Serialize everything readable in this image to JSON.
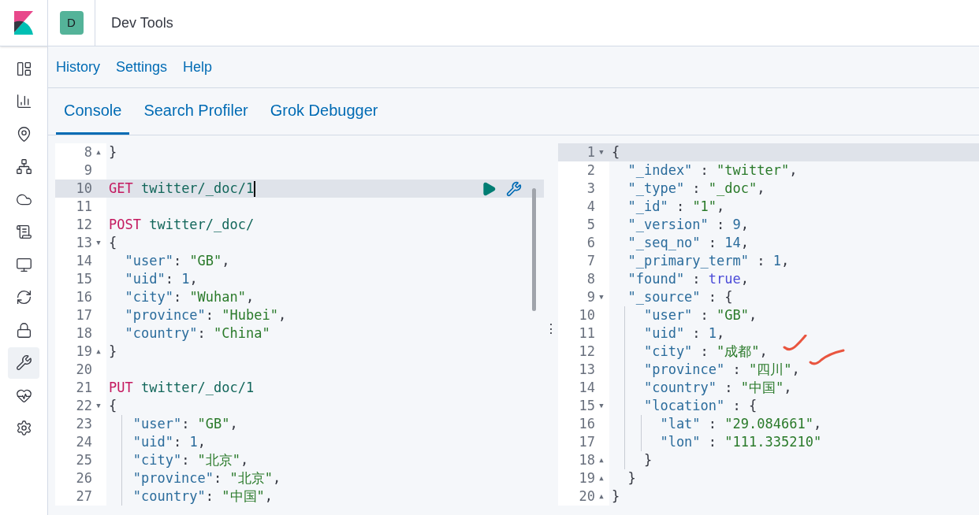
{
  "header": {
    "space_badge": "D",
    "title": "Dev Tools"
  },
  "nav": [
    {
      "selected": false
    },
    {
      "selected": false
    },
    {
      "selected": false
    },
    {
      "selected": false
    },
    {
      "selected": false
    },
    {
      "selected": false
    },
    {
      "selected": false
    },
    {
      "selected": false
    },
    {
      "selected": false
    },
    {
      "selected": true
    },
    {
      "selected": false
    },
    {
      "selected": false
    }
  ],
  "top_links": [
    "History",
    "Settings",
    "Help"
  ],
  "tabs": [
    {
      "label": "Console",
      "selected": true
    },
    {
      "label": "Search Profiler",
      "selected": false
    },
    {
      "label": "Grok Debugger",
      "selected": false
    }
  ],
  "request_editor": {
    "lines": [
      {
        "number": "8",
        "fold": "▲",
        "tokens": [
          {
            "kind": "punct",
            "text": "}"
          }
        ]
      },
      {
        "number": "9"
      },
      {
        "number": "10",
        "selected": true,
        "tokens": [
          {
            "kind": "method",
            "text": "GET"
          },
          {
            "kind": "path",
            "text": " twitter/_doc/1"
          }
        ]
      },
      {
        "number": "11"
      },
      {
        "number": "12",
        "tokens": [
          {
            "kind": "method",
            "text": "POST"
          },
          {
            "kind": "path",
            "text": " twitter/_doc/"
          }
        ]
      },
      {
        "number": "13",
        "fold": "▼",
        "tokens": [
          {
            "kind": "punct",
            "text": "{"
          }
        ]
      },
      {
        "number": "14",
        "tokens": [
          {
            "kind": "key",
            "text": "  \"user\""
          },
          {
            "kind": "punct",
            "text": ": "
          },
          {
            "kind": "string",
            "text": "\"GB\""
          },
          {
            "kind": "punct",
            "text": ","
          }
        ]
      },
      {
        "number": "15",
        "tokens": [
          {
            "kind": "key",
            "text": "  \"uid\""
          },
          {
            "kind": "punct",
            "text": ": "
          },
          {
            "kind": "number",
            "text": "1"
          },
          {
            "kind": "punct",
            "text": ","
          }
        ]
      },
      {
        "number": "16",
        "tokens": [
          {
            "kind": "key",
            "text": "  \"city\""
          },
          {
            "kind": "punct",
            "text": ": "
          },
          {
            "kind": "string",
            "text": "\"Wuhan\""
          },
          {
            "kind": "punct",
            "text": ","
          }
        ]
      },
      {
        "number": "17",
        "tokens": [
          {
            "kind": "key",
            "text": "  \"province\""
          },
          {
            "kind": "punct",
            "text": ": "
          },
          {
            "kind": "string",
            "text": "\"Hubei\""
          },
          {
            "kind": "punct",
            "text": ","
          }
        ]
      },
      {
        "number": "18",
        "tokens": [
          {
            "kind": "key",
            "text": "  \"country\""
          },
          {
            "kind": "punct",
            "text": ": "
          },
          {
            "kind": "string",
            "text": "\"China\""
          }
        ]
      },
      {
        "number": "19",
        "fold": "▲",
        "tokens": [
          {
            "kind": "punct",
            "text": "}"
          }
        ]
      },
      {
        "number": "20"
      },
      {
        "number": "21",
        "tokens": [
          {
            "kind": "method",
            "text": "PUT"
          },
          {
            "kind": "path",
            "text": " twitter/_doc/1"
          }
        ]
      },
      {
        "number": "22",
        "fold": "▼",
        "tokens": [
          {
            "kind": "punct",
            "text": "{"
          }
        ]
      },
      {
        "number": "23",
        "tokens": [
          {
            "kind": "guide"
          },
          {
            "kind": "key",
            "text": " \"user\""
          },
          {
            "kind": "punct",
            "text": ": "
          },
          {
            "kind": "string",
            "text": "\"GB\""
          },
          {
            "kind": "punct",
            "text": ","
          }
        ]
      },
      {
        "number": "24",
        "tokens": [
          {
            "kind": "guide"
          },
          {
            "kind": "key",
            "text": " \"uid\""
          },
          {
            "kind": "punct",
            "text": ": "
          },
          {
            "kind": "number",
            "text": "1"
          },
          {
            "kind": "punct",
            "text": ","
          }
        ]
      },
      {
        "number": "25",
        "tokens": [
          {
            "kind": "guide"
          },
          {
            "kind": "key",
            "text": " \"city\""
          },
          {
            "kind": "punct",
            "text": ": "
          },
          {
            "kind": "string",
            "text": "\"北京\""
          },
          {
            "kind": "punct",
            "text": ","
          }
        ]
      },
      {
        "number": "26",
        "tokens": [
          {
            "kind": "guide"
          },
          {
            "kind": "key",
            "text": " \"province\""
          },
          {
            "kind": "punct",
            "text": ": "
          },
          {
            "kind": "string",
            "text": "\"北京\""
          },
          {
            "kind": "punct",
            "text": ","
          }
        ]
      },
      {
        "number": "27",
        "tokens": [
          {
            "kind": "guide"
          },
          {
            "kind": "key",
            "text": " \"country\""
          },
          {
            "kind": "punct",
            "text": ": "
          },
          {
            "kind": "string",
            "text": "\"中国\""
          },
          {
            "kind": "punct",
            "text": ","
          }
        ]
      }
    ]
  },
  "resize_handle": "⋮",
  "response_editor": {
    "lines": [
      {
        "number": "1",
        "fold": "▼",
        "selected": true,
        "tokens": [
          {
            "kind": "punct",
            "text": "{"
          }
        ]
      },
      {
        "number": "2",
        "tokens": [
          {
            "kind": "key",
            "text": "  \"_index\""
          },
          {
            "kind": "punct",
            "text": " : "
          },
          {
            "kind": "string",
            "text": "\"twitter\""
          },
          {
            "kind": "punct",
            "text": ","
          }
        ]
      },
      {
        "number": "3",
        "tokens": [
          {
            "kind": "key",
            "text": "  \"_type\""
          },
          {
            "kind": "punct",
            "text": " : "
          },
          {
            "kind": "string",
            "text": "\"_doc\""
          },
          {
            "kind": "punct",
            "text": ","
          }
        ]
      },
      {
        "number": "4",
        "tokens": [
          {
            "kind": "key",
            "text": "  \"_id\""
          },
          {
            "kind": "punct",
            "text": " : "
          },
          {
            "kind": "string",
            "text": "\"1\""
          },
          {
            "kind": "punct",
            "text": ","
          }
        ]
      },
      {
        "number": "5",
        "tokens": [
          {
            "kind": "key",
            "text": "  \"_version\""
          },
          {
            "kind": "punct",
            "text": " : "
          },
          {
            "kind": "number",
            "text": "9"
          },
          {
            "kind": "punct",
            "text": ","
          }
        ]
      },
      {
        "number": "6",
        "tokens": [
          {
            "kind": "key",
            "text": "  \"_seq_no\""
          },
          {
            "kind": "punct",
            "text": " : "
          },
          {
            "kind": "number",
            "text": "14"
          },
          {
            "kind": "punct",
            "text": ","
          }
        ]
      },
      {
        "number": "7",
        "tokens": [
          {
            "kind": "key",
            "text": "  \"_primary_term\""
          },
          {
            "kind": "punct",
            "text": " : "
          },
          {
            "kind": "number",
            "text": "1"
          },
          {
            "kind": "punct",
            "text": ","
          }
        ]
      },
      {
        "number": "8",
        "tokens": [
          {
            "kind": "key",
            "text": "  \"found\""
          },
          {
            "kind": "punct",
            "text": " : "
          },
          {
            "kind": "bool",
            "text": "true"
          },
          {
            "kind": "punct",
            "text": ","
          }
        ]
      },
      {
        "number": "9",
        "fold": "▼",
        "tokens": [
          {
            "kind": "key",
            "text": "  \"_source\""
          },
          {
            "kind": "punct",
            "text": " : {"
          }
        ]
      },
      {
        "number": "10",
        "tokens": [
          {
            "kind": "guide"
          },
          {
            "kind": "key",
            "text": "  \"user\""
          },
          {
            "kind": "punct",
            "text": " : "
          },
          {
            "kind": "string",
            "text": "\"GB\""
          },
          {
            "kind": "punct",
            "text": ","
          }
        ]
      },
      {
        "number": "11",
        "tokens": [
          {
            "kind": "guide"
          },
          {
            "kind": "key",
            "text": "  \"uid\""
          },
          {
            "kind": "punct",
            "text": " : "
          },
          {
            "kind": "number",
            "text": "1"
          },
          {
            "kind": "punct",
            "text": ","
          }
        ]
      },
      {
        "number": "12",
        "tokens": [
          {
            "kind": "guide"
          },
          {
            "kind": "key",
            "text": "  \"city\""
          },
          {
            "kind": "punct",
            "text": " : "
          },
          {
            "kind": "string",
            "text": "\"成都\""
          },
          {
            "kind": "punct",
            "text": ","
          }
        ]
      },
      {
        "number": "13",
        "tokens": [
          {
            "kind": "guide"
          },
          {
            "kind": "key",
            "text": "  \"province\""
          },
          {
            "kind": "punct",
            "text": " : "
          },
          {
            "kind": "string",
            "text": "\"四川\""
          },
          {
            "kind": "punct",
            "text": ","
          }
        ]
      },
      {
        "number": "14",
        "tokens": [
          {
            "kind": "guide"
          },
          {
            "kind": "key",
            "text": "  \"country\""
          },
          {
            "kind": "punct",
            "text": " : "
          },
          {
            "kind": "string",
            "text": "\"中国\""
          },
          {
            "kind": "punct",
            "text": ","
          }
        ]
      },
      {
        "number": "15",
        "fold": "▼",
        "tokens": [
          {
            "kind": "guide"
          },
          {
            "kind": "key",
            "text": "  \"location\""
          },
          {
            "kind": "punct",
            "text": " : {"
          }
        ]
      },
      {
        "number": "16",
        "tokens": [
          {
            "kind": "guide"
          },
          {
            "kind": "guide"
          },
          {
            "kind": "key",
            "text": "  \"lat\""
          },
          {
            "kind": "punct",
            "text": " : "
          },
          {
            "kind": "string",
            "text": "\"29.084661\""
          },
          {
            "kind": "punct",
            "text": ","
          }
        ]
      },
      {
        "number": "17",
        "tokens": [
          {
            "kind": "guide"
          },
          {
            "kind": "guide"
          },
          {
            "kind": "key",
            "text": "  \"lon\""
          },
          {
            "kind": "punct",
            "text": " : "
          },
          {
            "kind": "string",
            "text": "\"111.335210\""
          }
        ]
      },
      {
        "number": "18",
        "fold": "▲",
        "tokens": [
          {
            "kind": "guide"
          },
          {
            "kind": "punct",
            "text": "  }"
          }
        ]
      },
      {
        "number": "19",
        "fold": "▲",
        "tokens": [
          {
            "kind": "punct",
            "text": "  }"
          }
        ]
      },
      {
        "number": "20",
        "fold": "▲",
        "tokens": [
          {
            "kind": "punct",
            "text": "}"
          }
        ]
      }
    ]
  }
}
